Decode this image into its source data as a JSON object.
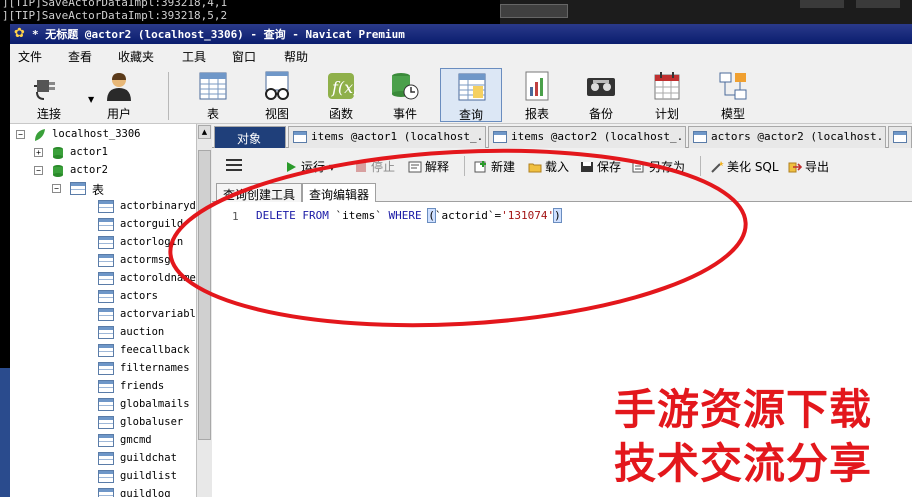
{
  "terminal": {
    "line1": "][TIP]SaveActorDataImpl:393218,4,1",
    "line2": "][TIP]SaveActorDataImpl:393218,5,2"
  },
  "window": {
    "title": "* 无标题 @actor2 (localhost_3306) - 查询 - Navicat Premium"
  },
  "menu": [
    "文件",
    "查看",
    "收藏夹",
    "工具",
    "窗口",
    "帮助"
  ],
  "toolbar": [
    {
      "label": "连接",
      "icon": "connection-plug-icon"
    },
    {
      "label": "用户",
      "icon": "user-icon"
    },
    {
      "label": "表",
      "icon": "table-icon"
    },
    {
      "label": "视图",
      "icon": "view-glasses-icon"
    },
    {
      "label": "函数",
      "icon": "function-icon"
    },
    {
      "label": "事件",
      "icon": "event-clock-icon"
    },
    {
      "label": "查询",
      "icon": "query-table-icon"
    },
    {
      "label": "报表",
      "icon": "report-icon"
    },
    {
      "label": "备份",
      "icon": "backup-tape-icon"
    },
    {
      "label": "计划",
      "icon": "schedule-calendar-icon"
    },
    {
      "label": "模型",
      "icon": "model-diagram-icon"
    }
  ],
  "tree": {
    "connection": "localhost_3306",
    "databases": [
      "actor1",
      "actor2"
    ],
    "group": "表",
    "tables": [
      "actorbinaryda",
      "actorguild",
      "actorlogin",
      "actormsg",
      "actoroldname",
      "actors",
      "actorvariable",
      "auction",
      "feecallback",
      "filternames",
      "friends",
      "globalmails",
      "globaluser",
      "gmcmd",
      "guildchat",
      "guildlist",
      "guildlog"
    ]
  },
  "tabs": [
    {
      "label": "对象"
    },
    {
      "label": "items @actor1 (localhost_..."
    },
    {
      "label": "items @actor2 (localhost_..."
    },
    {
      "label": "actors @actor2 (localhost..."
    }
  ],
  "query_toolbar": {
    "run": "运行",
    "stop": "停止",
    "explain": "解释",
    "new": "新建",
    "load": "载入",
    "save": "保存",
    "save_as": "另存为",
    "beautify": "美化 SQL",
    "export": "导出"
  },
  "subtabs": [
    "查询创建工具",
    "查询编辑器"
  ],
  "editor": {
    "line_number": "1",
    "kw_delete": "DELETE",
    "kw_from": "FROM",
    "table": "`items`",
    "kw_where": "WHERE",
    "open_paren": "(",
    "column": "`actorid`",
    "eq": "=",
    "value": "'131074'",
    "close_paren": ")"
  },
  "watermark": {
    "line1": "手游资源下载",
    "line2": "技术交流分享"
  },
  "colors": {
    "titlebar": "#0a1d6e",
    "annotation_red": "#e3171c",
    "keyword": "#1a1aa6",
    "string": "#a31515"
  }
}
